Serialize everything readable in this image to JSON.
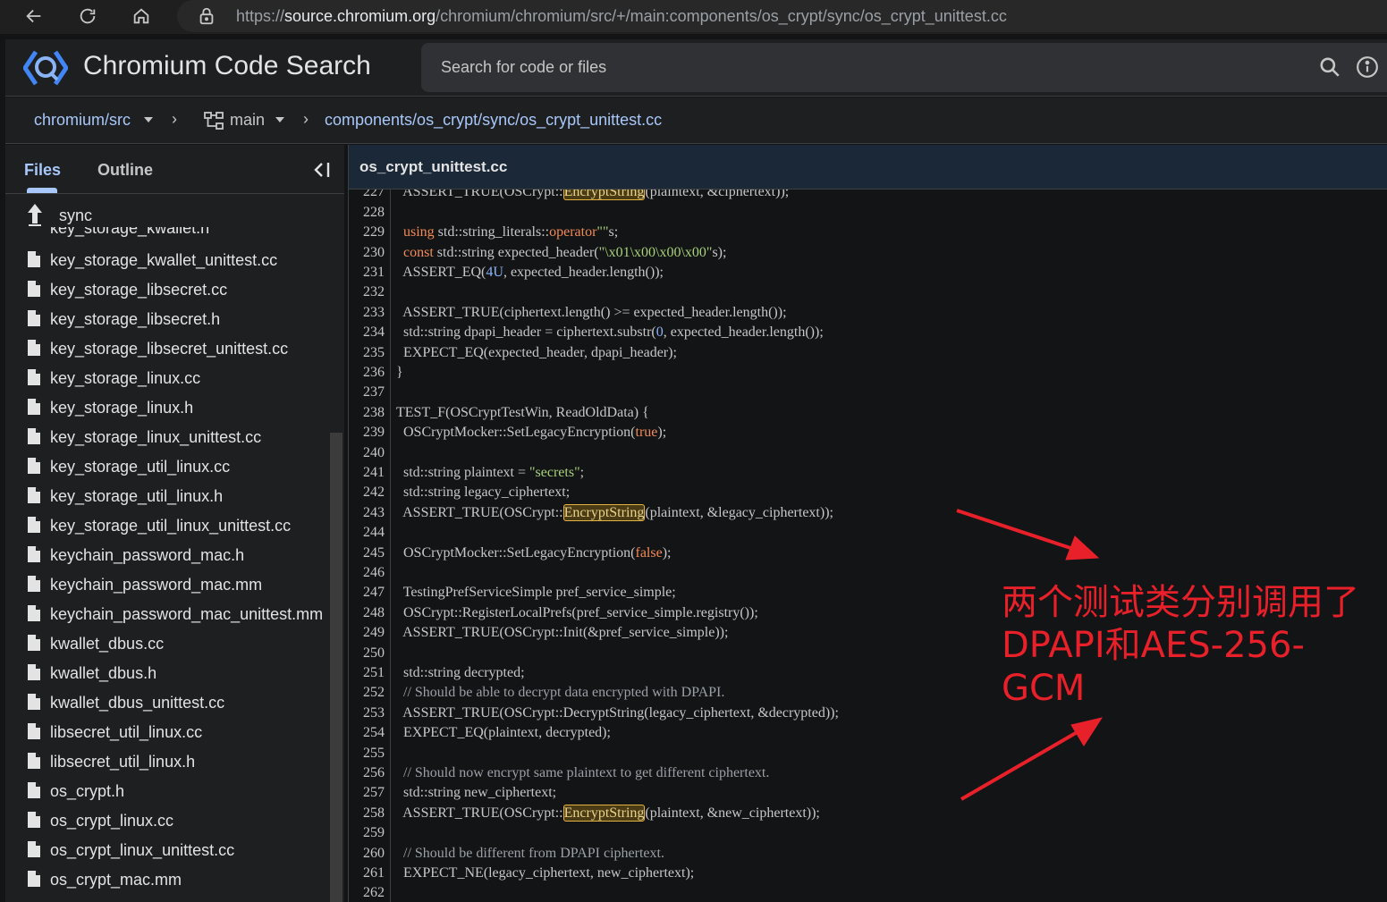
{
  "browser": {
    "url_prefix": "https://",
    "url_host": "source.chromium.org",
    "url_path": "/chromium/chromium/src/+/main:components/os_crypt/sync/os_crypt_unittest.cc"
  },
  "header": {
    "title": "Chromium Code Search",
    "search_placeholder": "Search for code or files"
  },
  "breadcrumb": {
    "repo": "chromium/src",
    "branch": "main",
    "path": "components/os_crypt/sync/os_crypt_unittest.cc"
  },
  "sidebar": {
    "tabs": [
      "Files",
      "Outline"
    ],
    "current_dir": "sync",
    "cut_file": "key_storage_kwallet.h",
    "files": [
      "key_storage_kwallet_unittest.cc",
      "key_storage_libsecret.cc",
      "key_storage_libsecret.h",
      "key_storage_libsecret_unittest.cc",
      "key_storage_linux.cc",
      "key_storage_linux.h",
      "key_storage_linux_unittest.cc",
      "key_storage_util_linux.cc",
      "key_storage_util_linux.h",
      "key_storage_util_linux_unittest.cc",
      "keychain_password_mac.h",
      "keychain_password_mac.mm",
      "keychain_password_mac_unittest.mm",
      "kwallet_dbus.cc",
      "kwallet_dbus.h",
      "kwallet_dbus_unittest.cc",
      "libsecret_util_linux.cc",
      "libsecret_util_linux.h",
      "os_crypt.h",
      "os_crypt_linux.cc",
      "os_crypt_linux_unittest.cc",
      "os_crypt_mac.mm"
    ]
  },
  "code": {
    "filename": "os_crypt_unittest.cc",
    "lines": [
      {
        "n": "227",
        "html": "  ASSERT_TRUE(OSCrypt::<span class=\"hl\">EncryptString</span>(plaintext, &amp;ciphertext));"
      },
      {
        "n": "228",
        "html": ""
      },
      {
        "n": "229",
        "html": "  <span class=\"kw\">using</span> std::string_literals::<span class=\"kw\">operator</span><span class=\"str\">\"\"</span>s;"
      },
      {
        "n": "230",
        "html": "  <span class=\"kw\">const</span> std::string expected_header(<span class=\"str\">\"\\x01\\x00\\x00\\x00\"</span>s);"
      },
      {
        "n": "231",
        "html": "  ASSERT_EQ(<span class=\"num\">4U</span>, expected_header.length());"
      },
      {
        "n": "232",
        "html": ""
      },
      {
        "n": "233",
        "html": "  ASSERT_TRUE(ciphertext.length() &gt;= expected_header.length());"
      },
      {
        "n": "234",
        "html": "  std::string dpapi_header = ciphertext.substr(<span class=\"num\">0</span>, expected_header.length());"
      },
      {
        "n": "235",
        "html": "  EXPECT_EQ(expected_header, dpapi_header);"
      },
      {
        "n": "236",
        "html": "}"
      },
      {
        "n": "237",
        "html": ""
      },
      {
        "n": "238",
        "html": "TEST_F(OSCryptTestWin, ReadOldData) {"
      },
      {
        "n": "239",
        "html": "  OSCryptMocker::SetLegacyEncryption(<span class=\"kw\">true</span>);"
      },
      {
        "n": "240",
        "html": ""
      },
      {
        "n": "241",
        "html": "  std::string plaintext = <span class=\"str\">\"secrets\"</span>;"
      },
      {
        "n": "242",
        "html": "  std::string legacy_ciphertext;"
      },
      {
        "n": "243",
        "html": "  ASSERT_TRUE(OSCrypt::<span class=\"hl\">EncryptString</span>(plaintext, &amp;legacy_ciphertext));"
      },
      {
        "n": "244",
        "html": ""
      },
      {
        "n": "245",
        "html": "  OSCryptMocker::SetLegacyEncryption(<span class=\"kw\">false</span>);"
      },
      {
        "n": "246",
        "html": ""
      },
      {
        "n": "247",
        "html": "  TestingPrefServiceSimple pref_service_simple;"
      },
      {
        "n": "248",
        "html": "  OSCrypt::RegisterLocalPrefs(pref_service_simple.registry());"
      },
      {
        "n": "249",
        "html": "  ASSERT_TRUE(OSCrypt::Init(&amp;pref_service_simple));"
      },
      {
        "n": "250",
        "html": ""
      },
      {
        "n": "251",
        "html": "  std::string decrypted;"
      },
      {
        "n": "252",
        "html": "  <span class=\"cmt\">// Should be able to decrypt data encrypted with DPAPI.</span>"
      },
      {
        "n": "253",
        "html": "  ASSERT_TRUE(OSCrypt::DecryptString(legacy_ciphertext, &amp;decrypted));"
      },
      {
        "n": "254",
        "html": "  EXPECT_EQ(plaintext, decrypted);"
      },
      {
        "n": "255",
        "html": ""
      },
      {
        "n": "256",
        "html": "  <span class=\"cmt\">// Should now encrypt same plaintext to get different ciphertext.</span>"
      },
      {
        "n": "257",
        "html": "  std::string new_ciphertext;"
      },
      {
        "n": "258",
        "html": "  ASSERT_TRUE(OSCrypt::<span class=\"hl\">EncryptString</span>(plaintext, &amp;new_ciphertext));"
      },
      {
        "n": "259",
        "html": ""
      },
      {
        "n": "260",
        "html": "  <span class=\"cmt\">// Should be different from DPAPI ciphertext.</span>"
      },
      {
        "n": "261",
        "html": "  EXPECT_NE(legacy_ciphertext, new_ciphertext);"
      },
      {
        "n": "262",
        "html": ""
      }
    ]
  },
  "annotation": {
    "line1": "两个测试类分别调用了",
    "line2": "DPAPI和AES-256-GCM",
    "color": "#e8202a"
  }
}
